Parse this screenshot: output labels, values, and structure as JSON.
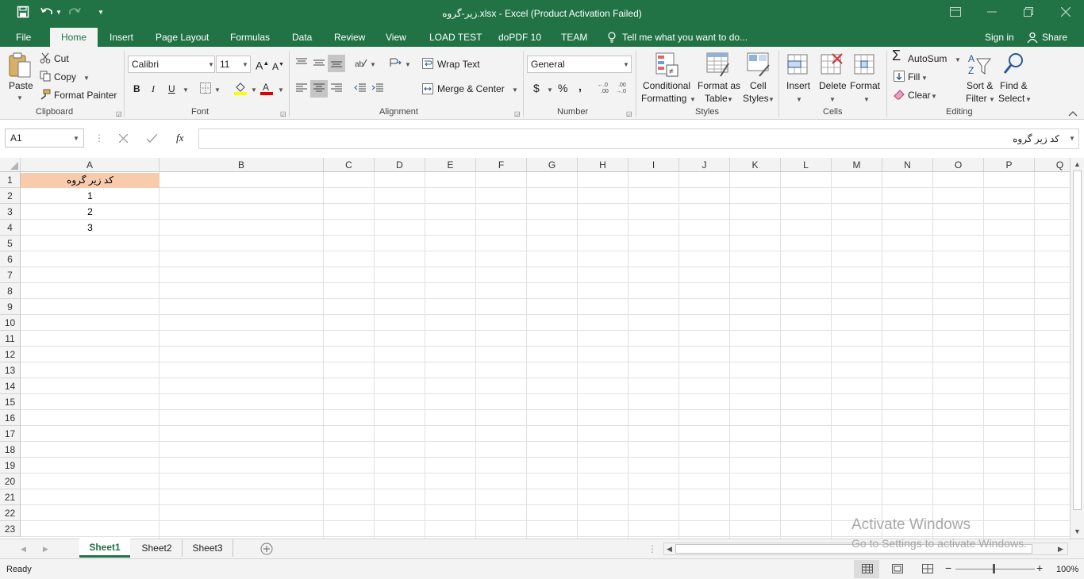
{
  "window": {
    "title": "زیر-گروه.xlsx - Excel (Product Activation Failed)"
  },
  "ribbon_tabs": [
    "File",
    "Home",
    "Insert",
    "Page Layout",
    "Formulas",
    "Data",
    "Review",
    "View",
    "LOAD TEST",
    "doPDF 10",
    "TEAM"
  ],
  "tell_me": "Tell me what you want to do...",
  "sign_in": "Sign in",
  "share": "Share",
  "clipboard": {
    "paste": "Paste",
    "cut": "Cut",
    "copy": "Copy",
    "format_painter": "Format Painter",
    "group": "Clipboard"
  },
  "font": {
    "name": "Calibri",
    "size": "11",
    "bold": "B",
    "italic": "I",
    "underline": "U",
    "group": "Font"
  },
  "alignment": {
    "wrap_text": "Wrap Text",
    "merge_center": "Merge & Center",
    "group": "Alignment"
  },
  "number": {
    "format": "General",
    "currency": "$",
    "percent": "%",
    "comma": ",",
    "group": "Number"
  },
  "styles": {
    "conditional_1": "Conditional",
    "conditional_2": "Formatting",
    "format_table_1": "Format as",
    "format_table_2": "Table",
    "cell_styles_1": "Cell",
    "cell_styles_2": "Styles",
    "group": "Styles"
  },
  "cells": {
    "insert": "Insert",
    "delete": "Delete",
    "format": "Format",
    "group": "Cells"
  },
  "editing": {
    "autosum": "AutoSum",
    "fill": "Fill",
    "clear": "Clear",
    "sort_1": "Sort &",
    "sort_2": "Filter",
    "find_1": "Find &",
    "find_2": "Select",
    "group": "Editing"
  },
  "formula_bar": {
    "name_box": "A1",
    "fx": "fx",
    "content": "کد زیر گروه"
  },
  "columns": [
    "A",
    "B",
    "C",
    "D",
    "E",
    "F",
    "G",
    "H",
    "I",
    "J",
    "K",
    "L",
    "M",
    "N",
    "O",
    "P",
    "Q"
  ],
  "rows": [
    "1",
    "2",
    "3",
    "4",
    "5",
    "6",
    "7",
    "8",
    "9",
    "10",
    "11",
    "12",
    "13",
    "14",
    "15",
    "16",
    "17",
    "18",
    "19",
    "20",
    "21",
    "22",
    "23"
  ],
  "cells_data": {
    "A1": "کد زیر گروه",
    "A2": "1",
    "A3": "2",
    "A4": "3"
  },
  "header_fill_color": "#f8cbad",
  "sheets": [
    "Sheet1",
    "Sheet2",
    "Sheet3"
  ],
  "active_sheet": "Sheet1",
  "watermark": {
    "line1": "Activate Windows",
    "line2": "Go to Settings to activate Windows."
  },
  "status": {
    "ready": "Ready",
    "zoom": "100%"
  },
  "accent_color": "#217346"
}
